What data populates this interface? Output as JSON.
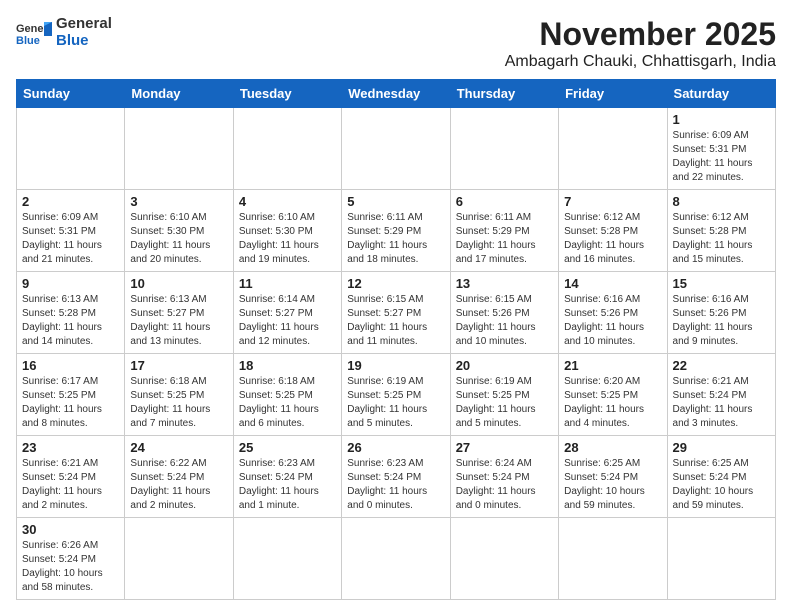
{
  "header": {
    "logo_general": "General",
    "logo_blue": "Blue",
    "month_year": "November 2025",
    "location": "Ambagarh Chauki, Chhattisgarh, India"
  },
  "weekdays": [
    "Sunday",
    "Monday",
    "Tuesday",
    "Wednesday",
    "Thursday",
    "Friday",
    "Saturday"
  ],
  "weeks": [
    [
      {
        "day": "",
        "info": ""
      },
      {
        "day": "",
        "info": ""
      },
      {
        "day": "",
        "info": ""
      },
      {
        "day": "",
        "info": ""
      },
      {
        "day": "",
        "info": ""
      },
      {
        "day": "",
        "info": ""
      },
      {
        "day": "1",
        "info": "Sunrise: 6:09 AM\nSunset: 5:31 PM\nDaylight: 11 hours and 22 minutes."
      }
    ],
    [
      {
        "day": "2",
        "info": "Sunrise: 6:09 AM\nSunset: 5:31 PM\nDaylight: 11 hours and 21 minutes."
      },
      {
        "day": "3",
        "info": "Sunrise: 6:10 AM\nSunset: 5:30 PM\nDaylight: 11 hours and 20 minutes."
      },
      {
        "day": "4",
        "info": "Sunrise: 6:10 AM\nSunset: 5:30 PM\nDaylight: 11 hours and 19 minutes."
      },
      {
        "day": "5",
        "info": "Sunrise: 6:11 AM\nSunset: 5:29 PM\nDaylight: 11 hours and 18 minutes."
      },
      {
        "day": "6",
        "info": "Sunrise: 6:11 AM\nSunset: 5:29 PM\nDaylight: 11 hours and 17 minutes."
      },
      {
        "day": "7",
        "info": "Sunrise: 6:12 AM\nSunset: 5:28 PM\nDaylight: 11 hours and 16 minutes."
      },
      {
        "day": "8",
        "info": "Sunrise: 6:12 AM\nSunset: 5:28 PM\nDaylight: 11 hours and 15 minutes."
      }
    ],
    [
      {
        "day": "9",
        "info": "Sunrise: 6:13 AM\nSunset: 5:28 PM\nDaylight: 11 hours and 14 minutes."
      },
      {
        "day": "10",
        "info": "Sunrise: 6:13 AM\nSunset: 5:27 PM\nDaylight: 11 hours and 13 minutes."
      },
      {
        "day": "11",
        "info": "Sunrise: 6:14 AM\nSunset: 5:27 PM\nDaylight: 11 hours and 12 minutes."
      },
      {
        "day": "12",
        "info": "Sunrise: 6:15 AM\nSunset: 5:27 PM\nDaylight: 11 hours and 11 minutes."
      },
      {
        "day": "13",
        "info": "Sunrise: 6:15 AM\nSunset: 5:26 PM\nDaylight: 11 hours and 10 minutes."
      },
      {
        "day": "14",
        "info": "Sunrise: 6:16 AM\nSunset: 5:26 PM\nDaylight: 11 hours and 10 minutes."
      },
      {
        "day": "15",
        "info": "Sunrise: 6:16 AM\nSunset: 5:26 PM\nDaylight: 11 hours and 9 minutes."
      }
    ],
    [
      {
        "day": "16",
        "info": "Sunrise: 6:17 AM\nSunset: 5:25 PM\nDaylight: 11 hours and 8 minutes."
      },
      {
        "day": "17",
        "info": "Sunrise: 6:18 AM\nSunset: 5:25 PM\nDaylight: 11 hours and 7 minutes."
      },
      {
        "day": "18",
        "info": "Sunrise: 6:18 AM\nSunset: 5:25 PM\nDaylight: 11 hours and 6 minutes."
      },
      {
        "day": "19",
        "info": "Sunrise: 6:19 AM\nSunset: 5:25 PM\nDaylight: 11 hours and 5 minutes."
      },
      {
        "day": "20",
        "info": "Sunrise: 6:19 AM\nSunset: 5:25 PM\nDaylight: 11 hours and 5 minutes."
      },
      {
        "day": "21",
        "info": "Sunrise: 6:20 AM\nSunset: 5:25 PM\nDaylight: 11 hours and 4 minutes."
      },
      {
        "day": "22",
        "info": "Sunrise: 6:21 AM\nSunset: 5:24 PM\nDaylight: 11 hours and 3 minutes."
      }
    ],
    [
      {
        "day": "23",
        "info": "Sunrise: 6:21 AM\nSunset: 5:24 PM\nDaylight: 11 hours and 2 minutes."
      },
      {
        "day": "24",
        "info": "Sunrise: 6:22 AM\nSunset: 5:24 PM\nDaylight: 11 hours and 2 minutes."
      },
      {
        "day": "25",
        "info": "Sunrise: 6:23 AM\nSunset: 5:24 PM\nDaylight: 11 hours and 1 minute."
      },
      {
        "day": "26",
        "info": "Sunrise: 6:23 AM\nSunset: 5:24 PM\nDaylight: 11 hours and 0 minutes."
      },
      {
        "day": "27",
        "info": "Sunrise: 6:24 AM\nSunset: 5:24 PM\nDaylight: 11 hours and 0 minutes."
      },
      {
        "day": "28",
        "info": "Sunrise: 6:25 AM\nSunset: 5:24 PM\nDaylight: 10 hours and 59 minutes."
      },
      {
        "day": "29",
        "info": "Sunrise: 6:25 AM\nSunset: 5:24 PM\nDaylight: 10 hours and 59 minutes."
      }
    ],
    [
      {
        "day": "30",
        "info": "Sunrise: 6:26 AM\nSunset: 5:24 PM\nDaylight: 10 hours and 58 minutes."
      },
      {
        "day": "",
        "info": ""
      },
      {
        "day": "",
        "info": ""
      },
      {
        "day": "",
        "info": ""
      },
      {
        "day": "",
        "info": ""
      },
      {
        "day": "",
        "info": ""
      },
      {
        "day": "",
        "info": ""
      }
    ]
  ]
}
